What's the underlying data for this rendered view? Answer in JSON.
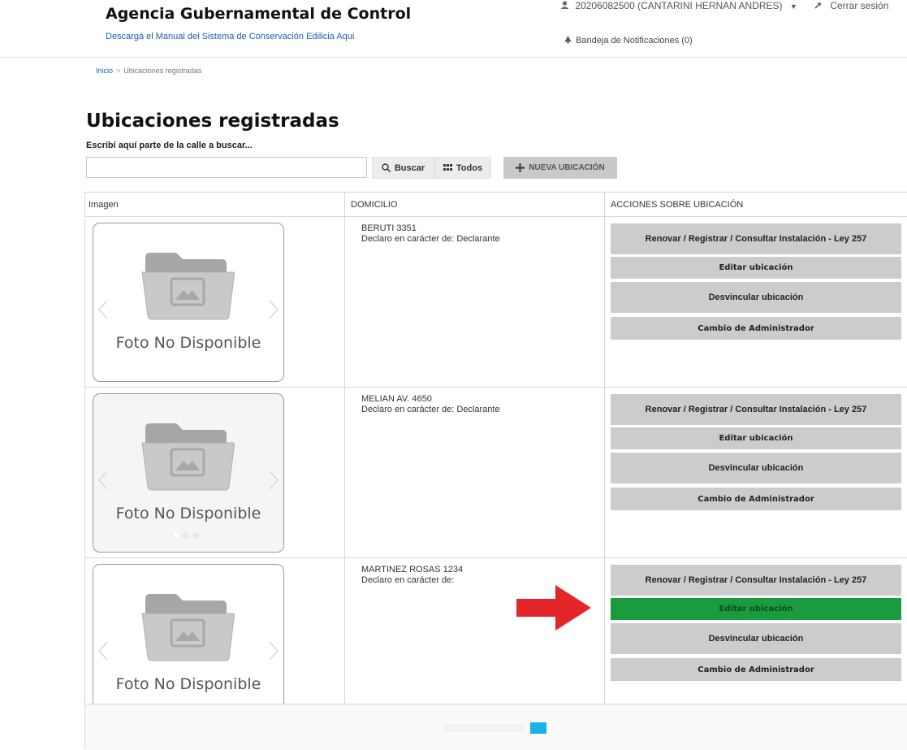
{
  "header": {
    "title": "Agencia Gubernamental de Control",
    "manual_link": "Descargá el Manual del Sistema de Conservación Edilicia Aqui",
    "user": "20206082500 (CANTARINI HERNAN ANDRES)",
    "logout": "Cerrar sesión",
    "notifications": "Bandeja de Notificaciones (0)"
  },
  "breadcrumb": {
    "home": "Inicio",
    "separator": ">",
    "current": "Ubicaciones registradas"
  },
  "page": {
    "title": "Ubicaciones registradas",
    "search_label": "Escribí aquí parte de la calle a buscar...",
    "search_value": "",
    "search_button": "Buscar",
    "all_button": "Todos",
    "new_button": "NUEVA UBICACIÓN"
  },
  "table": {
    "headers": [
      "Imagen",
      "DOMICILIO",
      "ACCIONES SOBRE UBICACIÓN"
    ],
    "photo_caption": "Foto No Disponible",
    "declared_label": "Declaro en carácter de:",
    "actions": {
      "renew": "Renovar / Registrar / Consultar Instalación - Ley 257",
      "edit": "Editar ubicación",
      "unlink": "Desvincular ubicación",
      "change_admin": "Cambio de Administrador"
    },
    "rows": [
      {
        "address": "BERUTI 3351",
        "declared_as": "Declarante"
      },
      {
        "address": "MELIAN AV. 4650",
        "declared_as": "Declarante"
      },
      {
        "address": "MARTINEZ ROSAS 1234",
        "declared_as": ""
      }
    ]
  },
  "colors": {
    "highlight_button": "#1a9c3e",
    "arrow": "#e3262a",
    "link": "#1a5fb4",
    "pager_active": "#1ab1e6"
  },
  "icons": [
    "user-icon",
    "logout-icon",
    "bell-icon",
    "search-icon",
    "grid-icon",
    "plus-icon",
    "folder-icon",
    "chevron-left-icon",
    "chevron-right-icon",
    "arrow-right-icon"
  ]
}
